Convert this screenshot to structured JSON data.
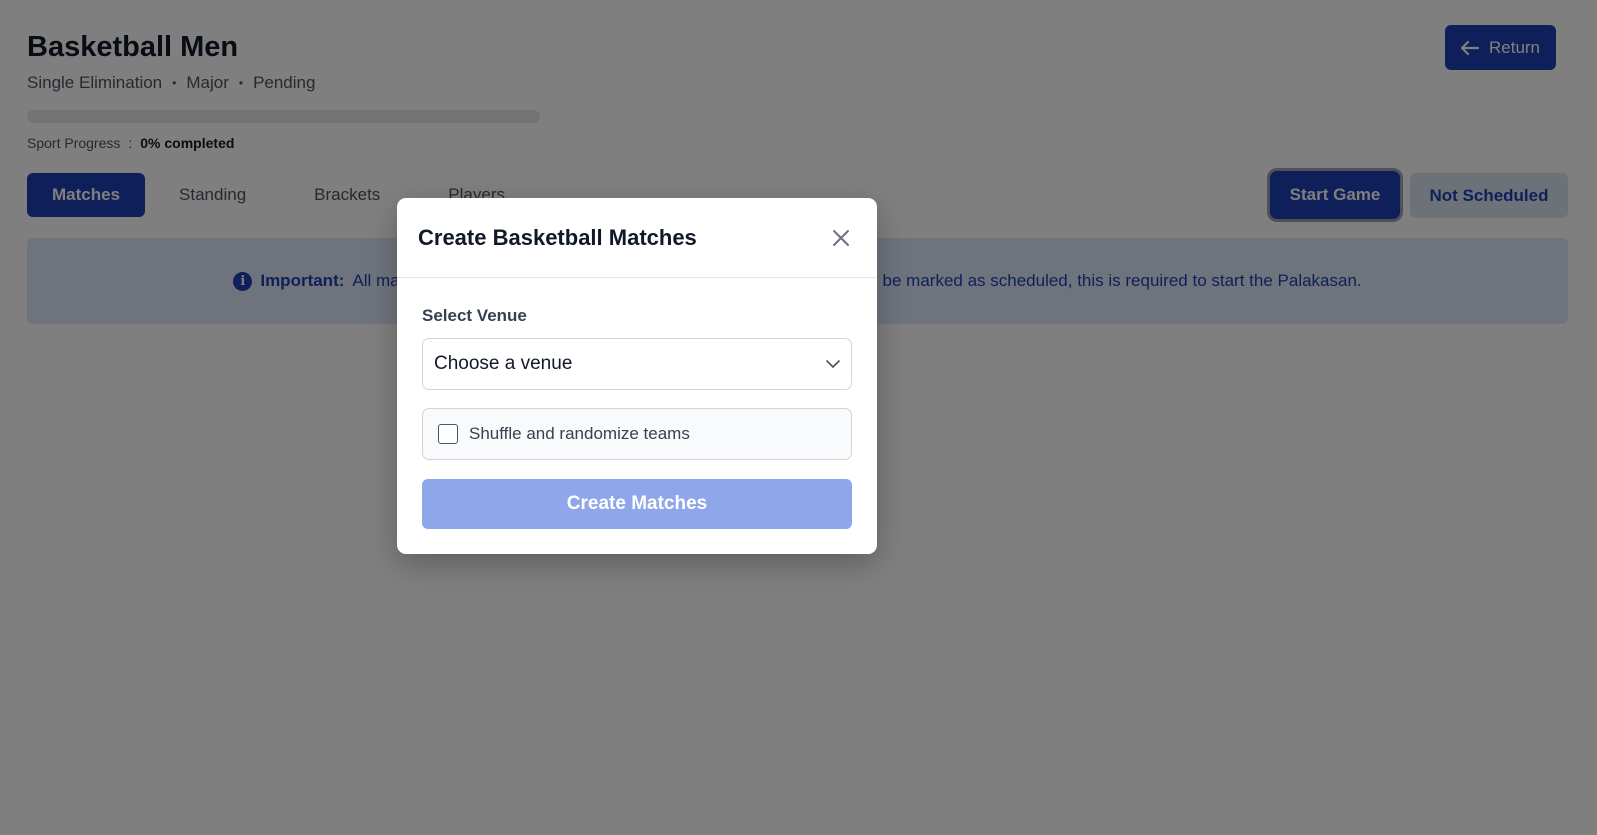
{
  "header": {
    "title": "Basketball Men",
    "format": "Single Elimination",
    "category": "Major",
    "status": "Pending",
    "separator": "•",
    "return_label": "Return"
  },
  "progress": {
    "label": "Sport Progress",
    "colon": ":",
    "value_text": "0% completed",
    "fraction": 0
  },
  "tabs": [
    {
      "label": "Matches",
      "active": true
    },
    {
      "label": "Standing",
      "active": false
    },
    {
      "label": "Brackets",
      "active": false
    },
    {
      "label": "Players",
      "active": false
    }
  ],
  "actions": {
    "start_label": "Start Game",
    "schedule_status": "Not Scheduled"
  },
  "notice": {
    "icon": "info-icon",
    "lead": "Important:",
    "text": "All matches must have a venue and schedule set before the sport can be marked as scheduled, this is required to start the Palakasan."
  },
  "modal": {
    "title": "Create Basketball Matches",
    "venue_label": "Select Venue",
    "venue_placeholder": "Choose a venue",
    "shuffle_label": "Shuffle and randomize teams",
    "shuffle_checked": false,
    "submit_label": "Create Matches"
  },
  "colors": {
    "primary": "#1e3fb5",
    "notice_bg": "#dfe8f8",
    "submit_disabled": "#8fa6ea"
  }
}
